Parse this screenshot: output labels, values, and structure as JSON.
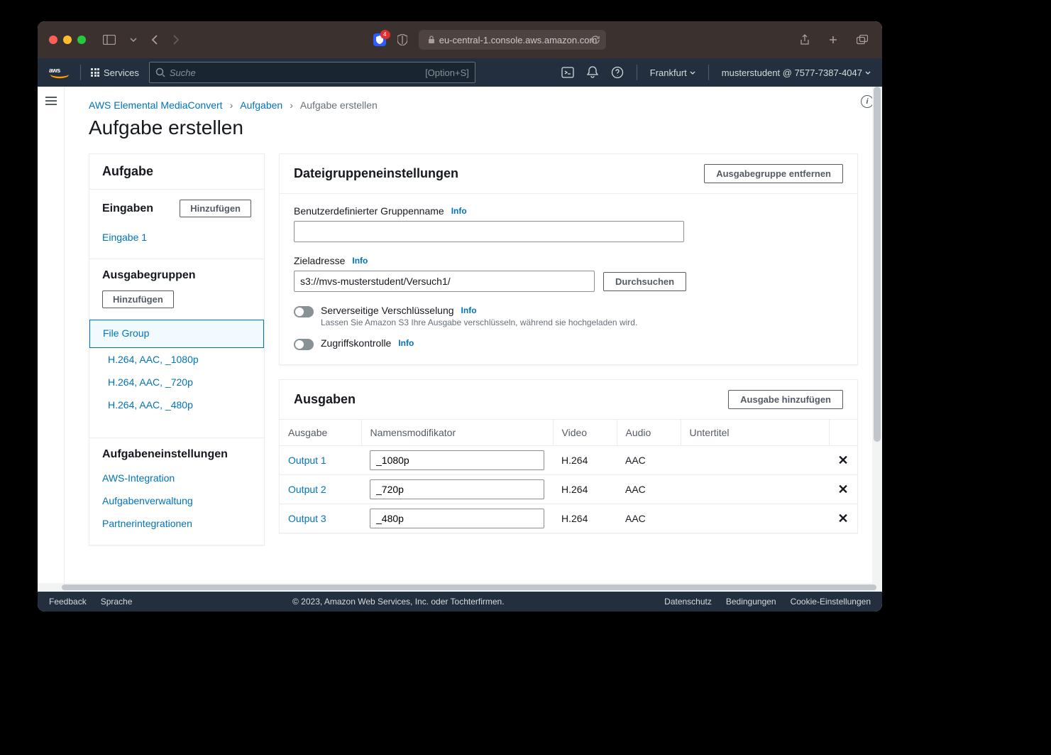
{
  "safari": {
    "url": "eu-central-1.console.aws.amazon.com",
    "extension_badge": "4"
  },
  "aws_header": {
    "logo": "aws",
    "services": "Services",
    "search_placeholder": "Suche",
    "search_hint": "[Option+S]",
    "region": "Frankfurt",
    "account": "musterstudent @ 7577-7387-4047"
  },
  "breadcrumb": {
    "root": "AWS Elemental MediaConvert",
    "level1": "Aufgaben",
    "current": "Aufgabe erstellen"
  },
  "page_title": "Aufgabe erstellen",
  "sidebar": {
    "title": "Aufgabe",
    "inputs": {
      "title": "Eingaben",
      "add": "Hinzufügen",
      "items": [
        "Eingabe 1"
      ]
    },
    "output_groups": {
      "title": "Ausgabegruppen",
      "add": "Hinzufügen",
      "selected": "File Group",
      "outputs": [
        "H.264, AAC, _1080p",
        "H.264, AAC, _720p",
        "H.264, AAC, _480p"
      ]
    },
    "settings": {
      "title": "Aufgabeneinstellungen",
      "items": [
        "AWS-Integration",
        "Aufgabenverwaltung",
        "Partnerintegrationen"
      ]
    }
  },
  "fg_settings": {
    "title": "Dateigruppeneinstellungen",
    "remove_btn": "Ausgabegruppe entfernen",
    "group_name_label": "Benutzerdefinierter Gruppenname",
    "group_name_value": "",
    "dest_label": "Zieladresse",
    "dest_value": "s3://mvs-musterstudent/Versuch1/",
    "browse_btn": "Durchsuchen",
    "encryption": {
      "label": "Serverseitige Verschlüsselung",
      "desc": "Lassen Sie Amazon S3 Ihre Ausgabe verschlüsseln, während sie hochgeladen wird."
    },
    "access": {
      "label": "Zugriffskontrolle"
    },
    "info": "Info"
  },
  "outputs": {
    "title": "Ausgaben",
    "add_btn": "Ausgabe hinzufügen",
    "columns": {
      "output": "Ausgabe",
      "mod": "Namensmodifikator",
      "video": "Video",
      "audio": "Audio",
      "sub": "Untertitel"
    },
    "rows": [
      {
        "name": "Output 1",
        "mod": "_1080p",
        "video": "H.264",
        "audio": "AAC",
        "sub": ""
      },
      {
        "name": "Output 2",
        "mod": "_720p",
        "video": "H.264",
        "audio": "AAC",
        "sub": ""
      },
      {
        "name": "Output 3",
        "mod": "_480p",
        "video": "H.264",
        "audio": "AAC",
        "sub": ""
      }
    ]
  },
  "footer": {
    "feedback": "Feedback",
    "language": "Sprache",
    "copyright": "© 2023, Amazon Web Services, Inc. oder Tochterfirmen.",
    "privacy": "Datenschutz",
    "terms": "Bedingungen",
    "cookies": "Cookie-Einstellungen"
  }
}
